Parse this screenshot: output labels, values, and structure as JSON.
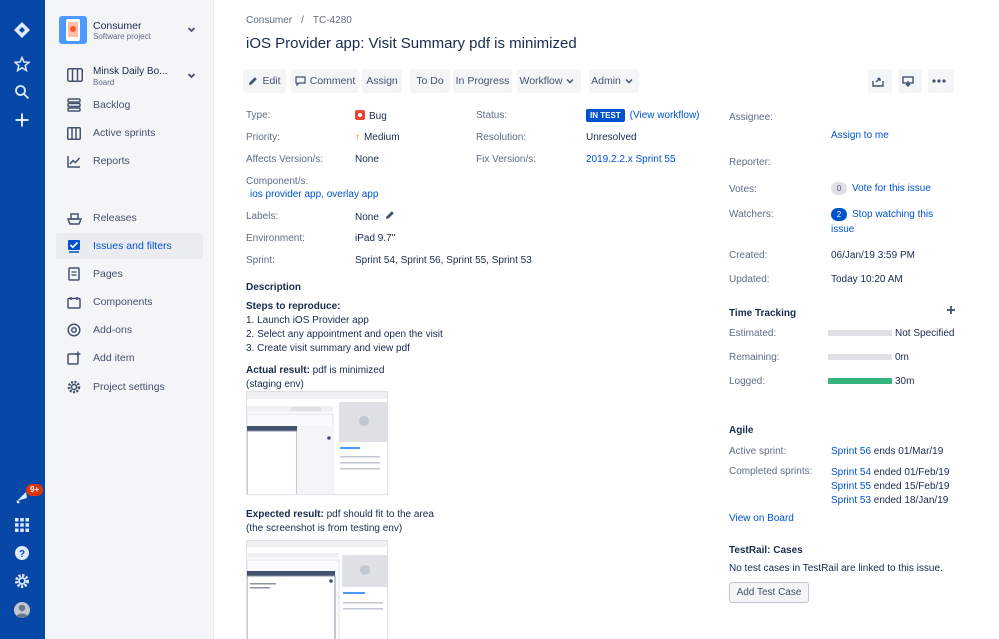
{
  "sidebar": {
    "project_name": "Consumer",
    "project_type": "Software project",
    "board_name": "Minsk Daily Bo...",
    "board_type": "Board",
    "items": [
      {
        "label": "Backlog"
      },
      {
        "label": "Active sprints"
      },
      {
        "label": "Reports"
      },
      {
        "label": "Releases"
      },
      {
        "label": "Issues and filters"
      },
      {
        "label": "Pages"
      },
      {
        "label": "Components"
      },
      {
        "label": "Add-ons"
      },
      {
        "label": "Add item"
      },
      {
        "label": "Project settings"
      }
    ]
  },
  "global_nav": {
    "notifications_badge": "9+"
  },
  "breadcrumb": {
    "project": "Consumer",
    "separator": "/",
    "issue_key": "TC-4280"
  },
  "issue": {
    "title": "iOS Provider app: Visit Summary pdf is minimized",
    "toolbar": {
      "edit": "Edit",
      "comment": "Comment",
      "assign": "Assign",
      "todo": "To Do",
      "in_progress": "In Progress",
      "workflow": "Workflow",
      "admin": "Admin"
    },
    "details": {
      "type_label": "Type:",
      "type_value": "Bug",
      "priority_label": "Priority:",
      "priority_value": "Medium",
      "affects_label": "Affects Version/s:",
      "affects_value": "None",
      "component_label": "Component/s:",
      "component_value": "ios provider app, overlay app",
      "labels_label": "Labels:",
      "labels_value": "None",
      "environment_label": "Environment:",
      "environment_value": "iPad 9.7\"",
      "sprint_label": "Sprint:",
      "sprint_value": "Sprint 54, Sprint 56, Sprint 55, Sprint 53",
      "status_label": "Status:",
      "status_value": "IN TEST",
      "view_workflow": "(View workflow)",
      "resolution_label": "Resolution:",
      "resolution_value": "Unresolved",
      "fix_label": "Fix Version/s:",
      "fix_value": "2019.2.2.x Sprint 55"
    },
    "description": {
      "heading": "Description",
      "steps_heading": "Steps to reproduce:",
      "steps": [
        "1. Launch iOS Provider app",
        "2. Select any appointment and open the visit",
        "3. Create visit summary and view pdf"
      ],
      "actual_label": "Actual result:",
      "actual_text": " pdf is minimized",
      "actual_note": "(staging env)",
      "expected_label": "Expected result:",
      "expected_text": " pdf should fit to the area",
      "expected_note": "(the screenshot is from testing env)"
    }
  },
  "people": {
    "assignee_label": "Assignee:",
    "assign_to_me": "Assign to me",
    "reporter_label": "Reporter:",
    "votes_label": "Votes:",
    "votes_count": "0",
    "vote_link": "Vote for this issue",
    "watchers_label": "Watchers:",
    "watchers_count": "2",
    "watch_link": "Stop watching this",
    "watch_link2": "issue"
  },
  "dates": {
    "created_label": "Created:",
    "created_value": "06/Jan/19 3:59 PM",
    "updated_label": "Updated:",
    "updated_value": "Today 10:20 AM"
  },
  "time_tracking": {
    "heading": "Time Tracking",
    "estimated_label": "Estimated:",
    "estimated_value": "Not Specified",
    "estimated_fill": 0,
    "remaining_label": "Remaining:",
    "remaining_value": "0m",
    "remaining_fill": 0,
    "logged_label": "Logged:",
    "logged_value": "30m",
    "logged_fill": 1
  },
  "agile": {
    "heading": "Agile",
    "active_label": "Active sprint:",
    "active_sprint": "Sprint 56",
    "active_ends": " ends 01/Mar/19",
    "completed_label": "Completed sprints:",
    "completed": [
      {
        "sprint": "Sprint 54",
        "ended": " ended 01/Feb/19"
      },
      {
        "sprint": "Sprint 55",
        "ended": " ended 15/Feb/19"
      },
      {
        "sprint": "Sprint 53",
        "ended": " ended 18/Jan/19"
      }
    ],
    "view_on_board": "View on Board"
  },
  "testrail": {
    "heading": "TestRail: Cases",
    "empty_text": "No test cases in TestRail are linked to this issue.",
    "add_button": "Add Test Case"
  },
  "colors": {
    "nav": "#0747a6",
    "link": "#0052cc",
    "logged": "#36b37e"
  }
}
